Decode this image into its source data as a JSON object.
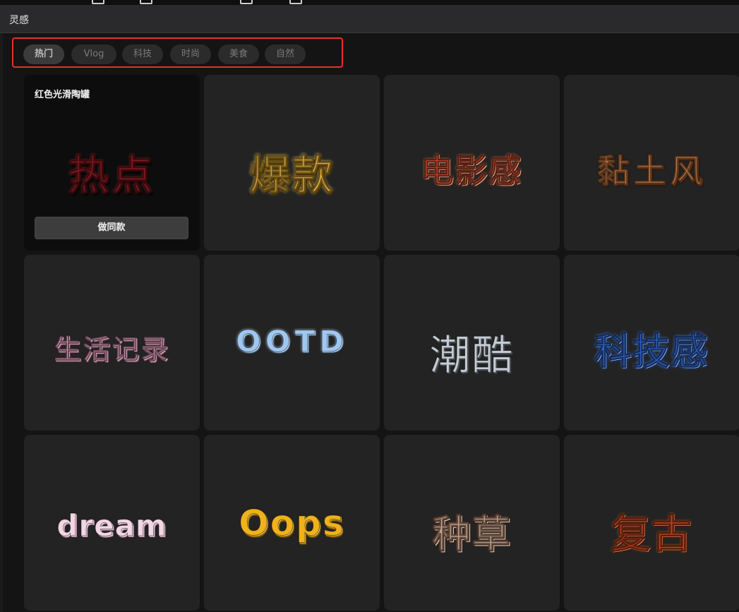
{
  "panel": {
    "title": "灵感"
  },
  "tabs": [
    {
      "label": "热门",
      "active": true
    },
    {
      "label": "Vlog",
      "active": false
    },
    {
      "label": "科技",
      "active": false
    },
    {
      "label": "时尚",
      "active": false
    },
    {
      "label": "美食",
      "active": false
    },
    {
      "label": "自然",
      "active": false
    }
  ],
  "hover_card": {
    "label": "红色光滑陶罐",
    "button_label": "做同款"
  },
  "cards": [
    {
      "text": "热点",
      "style": "red"
    },
    {
      "text": "爆款",
      "style": "gold"
    },
    {
      "text": "电影感",
      "style": "copper"
    },
    {
      "text": "黏土风",
      "style": "clay"
    },
    {
      "text": "生活记录",
      "style": "pink"
    },
    {
      "text": "OOTD",
      "style": "ice"
    },
    {
      "text": "潮酷",
      "style": "silver"
    },
    {
      "text": "科技感",
      "style": "blue"
    },
    {
      "text": "dream",
      "style": "rose"
    },
    {
      "text": "Oops",
      "style": "amber"
    },
    {
      "text": "种草",
      "style": "metal"
    },
    {
      "text": "复古",
      "style": "rust"
    }
  ]
}
